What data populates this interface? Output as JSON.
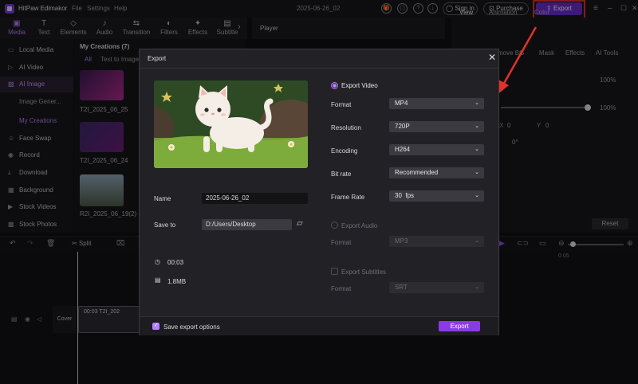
{
  "app": {
    "name": "HitPaw Edimakor",
    "menu": [
      "File",
      "Settings",
      "Help"
    ],
    "project_name": "2025-06-26_02",
    "sign_in": "Sign in",
    "purchase": "Purchase",
    "export": "Export"
  },
  "toolbar": {
    "tabs": [
      {
        "label": "Media",
        "icon": "media-icon"
      },
      {
        "label": "Text",
        "icon": "text-icon"
      },
      {
        "label": "Elements",
        "icon": "elements-icon"
      },
      {
        "label": "Audio",
        "icon": "audio-icon"
      },
      {
        "label": "Transition",
        "icon": "transition-icon"
      },
      {
        "label": "Filters",
        "icon": "filters-icon"
      },
      {
        "label": "Effects",
        "icon": "effects-icon"
      },
      {
        "label": "Subtitle",
        "icon": "subtitle-icon"
      }
    ]
  },
  "sidebar": {
    "items": [
      {
        "label": "Local Media"
      },
      {
        "label": "AI Video"
      },
      {
        "label": "AI Image"
      },
      {
        "label": "Image Gener..."
      },
      {
        "label": "My Creations"
      },
      {
        "label": "Face Swap"
      },
      {
        "label": "Record"
      },
      {
        "label": "Download"
      },
      {
        "label": "Background"
      },
      {
        "label": "Stock Videos"
      },
      {
        "label": "Stock Photos"
      }
    ]
  },
  "media_panel": {
    "title": "My Creations (7)",
    "filters": [
      "All",
      "Text to Image"
    ],
    "items": [
      "T2I_2025_06_25",
      "T2I_2025_06_24",
      "R2I_2025_06_19(2)"
    ]
  },
  "player": {
    "title": "Player"
  },
  "right_panel": {
    "tabs": [
      "View",
      "Animation",
      "Color"
    ],
    "sub_tabs": [
      "move BG",
      "Mask",
      "Effects",
      "AI Tools"
    ],
    "percent_1": "100%",
    "percent_2": "100%",
    "x_label": "X",
    "x_value": "0",
    "y_label": "Y",
    "y_value": "0",
    "rotation": "0°",
    "reset": "Reset"
  },
  "timeline": {
    "split": "Split",
    "cover": "Cover",
    "clip_label": "00:03 T2I_202",
    "ruler_mark": "0:05"
  },
  "dialog": {
    "title": "Export",
    "name_label": "Name",
    "name_value": "2025-06-26_02",
    "save_to_label": "Save to",
    "save_to_value": "D:/Users/Desktop",
    "duration": "00:03",
    "size": "1.8MB",
    "export_video": {
      "label": "Export Video",
      "format_label": "Format",
      "format": "MP4",
      "resolution_label": "Resolution",
      "resolution": "720P",
      "encoding_label": "Encoding",
      "encoding": "H264",
      "bitrate_label": "Bit rate",
      "bitrate": "Recommended",
      "framerate_label": "Frame Rate",
      "framerate": "30  fps"
    },
    "export_audio": {
      "label": "Export Audio",
      "format_label": "Format",
      "format": "MP3"
    },
    "export_subtitles": {
      "label": "Export Subtitles",
      "format_label": "Format",
      "format": "SRT"
    },
    "save_options": "Save export options",
    "export_button": "Export"
  },
  "colors": {
    "accent": "#b77cff",
    "export_button": "#8a3be6",
    "highlight": "#e0322b"
  }
}
